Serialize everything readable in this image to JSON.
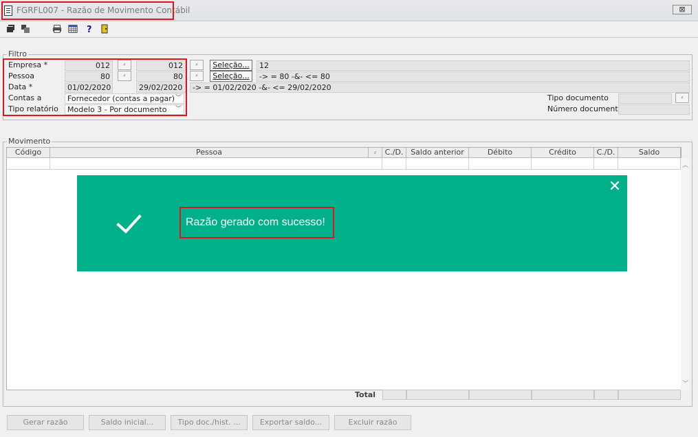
{
  "window": {
    "title": "FGRFL007 - Razão de Movimento Contábil",
    "close_label": "⊠"
  },
  "toolbar": {
    "icons": [
      "export-icon",
      "windows-icon",
      "print-icon",
      "calendar-icon",
      "help-icon",
      "exit-door-icon"
    ]
  },
  "filtro": {
    "group_label": "Filtro",
    "empresa": {
      "label": "Empresa *",
      "from": "012",
      "to": "012",
      "sel_label": "Seleção...",
      "summary": "12"
    },
    "pessoa": {
      "label": "Pessoa",
      "from": "80",
      "to": "80",
      "sel_label": "Seleção...",
      "summary": "-> = 80 -&- <= 80"
    },
    "data": {
      "label": "Data *",
      "from": "01/02/2020",
      "to": "29/02/2020",
      "summary": "-> = 01/02/2020 -&- <= 29/02/2020"
    },
    "contas_a": {
      "label": "Contas a",
      "value": "Fornecedor (contas a pagar)"
    },
    "tipo_relatorio": {
      "label": "Tipo relatório",
      "value": "Modelo 3 - Por documento"
    },
    "tipo_documento": {
      "label": "Tipo documento",
      "value": ""
    },
    "numero_documento": {
      "label": "Número documento",
      "value": ""
    }
  },
  "movimento": {
    "group_label": "Movimento",
    "columns": [
      "Código",
      "Pessoa",
      "C./D.",
      "Saldo anterior",
      "Débito",
      "Crédito",
      "C./D.",
      "Saldo"
    ],
    "total_label": "Total"
  },
  "toast": {
    "message": "Razão gerado com sucesso!",
    "background": "#00b08b"
  },
  "buttons": {
    "gerar": "Gerar razão",
    "saldo_inicial": "Saldo inicial...",
    "tipo_doc": "Tipo doc./hist. ...",
    "exportar": "Exportar saldo...",
    "excluir": "Excluir razão"
  }
}
